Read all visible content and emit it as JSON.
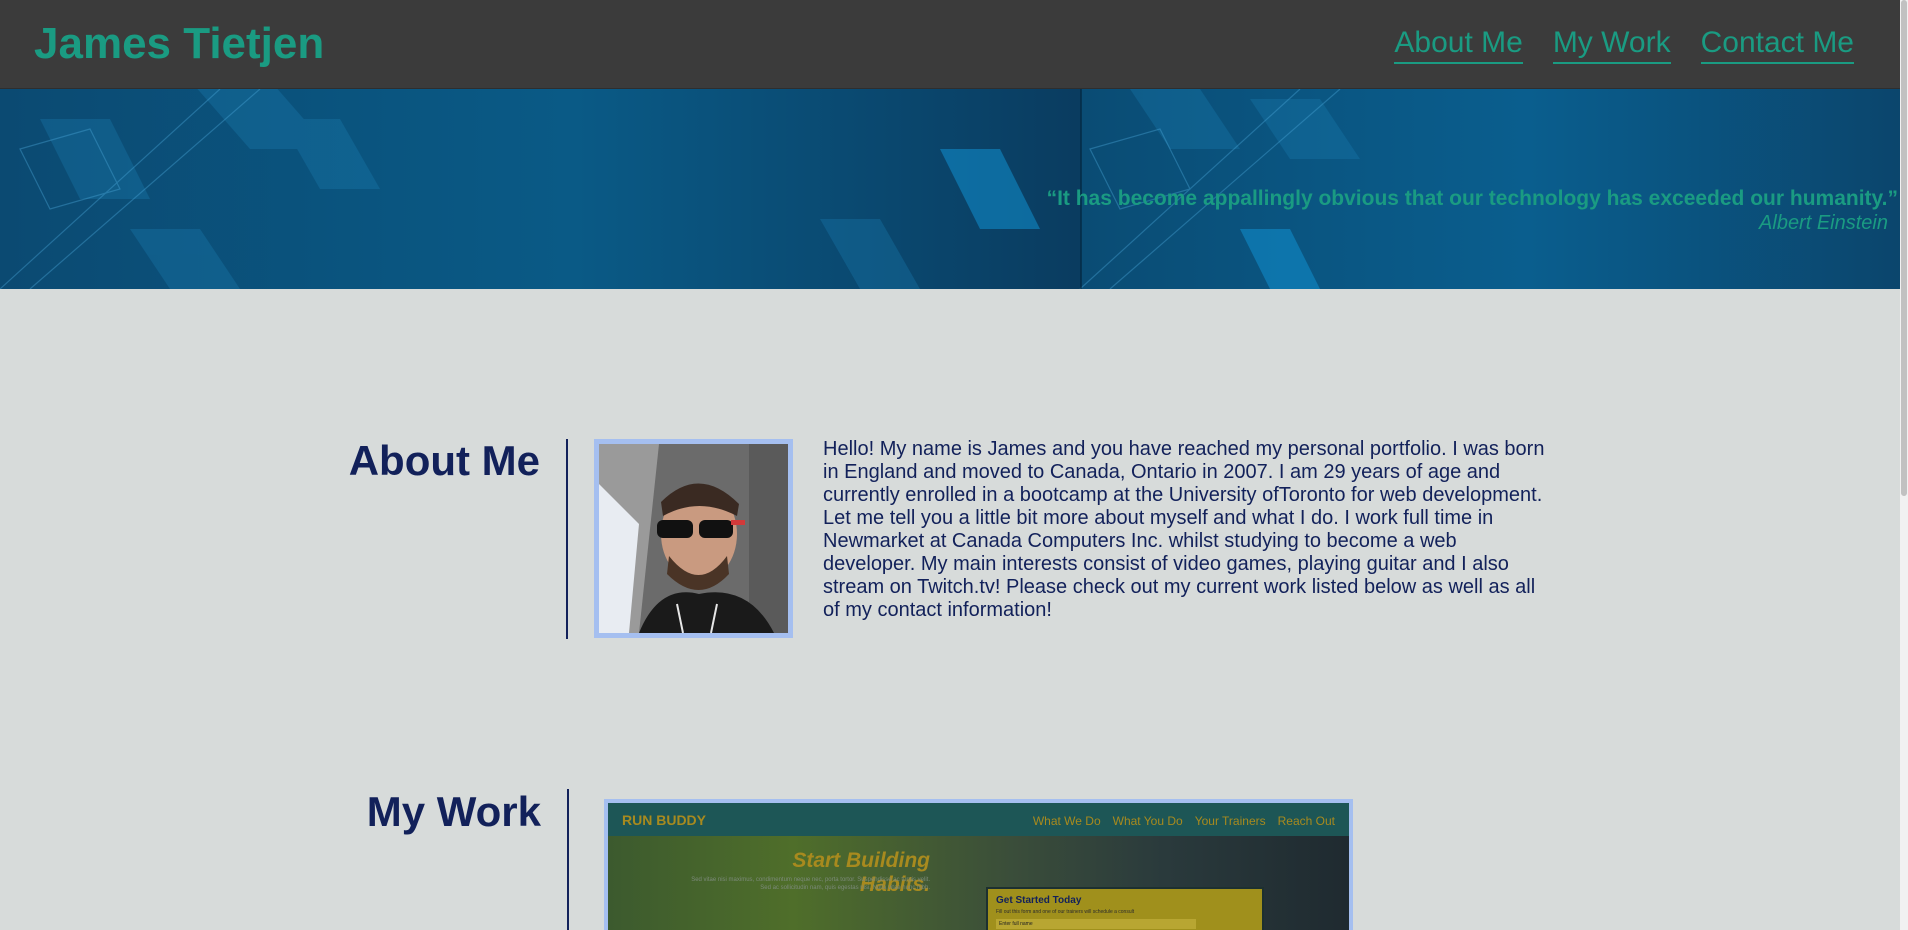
{
  "header": {
    "title": "James Tietjen",
    "nav": [
      "About Me",
      "My Work",
      "Contact Me"
    ]
  },
  "hero": {
    "quote": "“It has become appallingly obvious that our technology has exceeded our humanity.”",
    "author": "Albert Einstein"
  },
  "about": {
    "heading": "About Me",
    "paragraph": "Hello! My name is James and you have reached my personal portfolio. I was born in England and moved to Canada, Ontario in 2007. I am 29 years of age and currently enrolled in a bootcamp at the University ofToronto for web development. Let me tell you a little bit more about myself and what I do. I work full time in Newmarket at Canada Computers Inc. whilst studying to become a web developer. My main interests consist of video games, playing guitar and I also stream on Twitch.tv! Please check out my current work listed below as well as all of my contact information!"
  },
  "work": {
    "heading": "My Work",
    "preview": {
      "brand": "RUN BUDDY",
      "links": [
        "What We Do",
        "What You Do",
        "Your Trainers",
        "Reach Out"
      ],
      "headline": "Start Building Habits.",
      "subtext": "Sed vitae nisi maximus, condimentum neque nec, porta tortor. Suspendisse ac turpis velit. Sed ac sollicitudin nam, quis egestas nisi. Nulla vitae nunc nibh.",
      "form_title": "Get Started Today",
      "form_subtitle": "Fill out this form and one of our trainers will schedule a consult",
      "form_placeholder": "Enter full name"
    }
  },
  "colors": {
    "accent": "#1a9b82",
    "header_bg": "#3b3b3b",
    "body_bg": "#d7dbda",
    "heading": "#12215a",
    "frame": "#a5bff0"
  }
}
